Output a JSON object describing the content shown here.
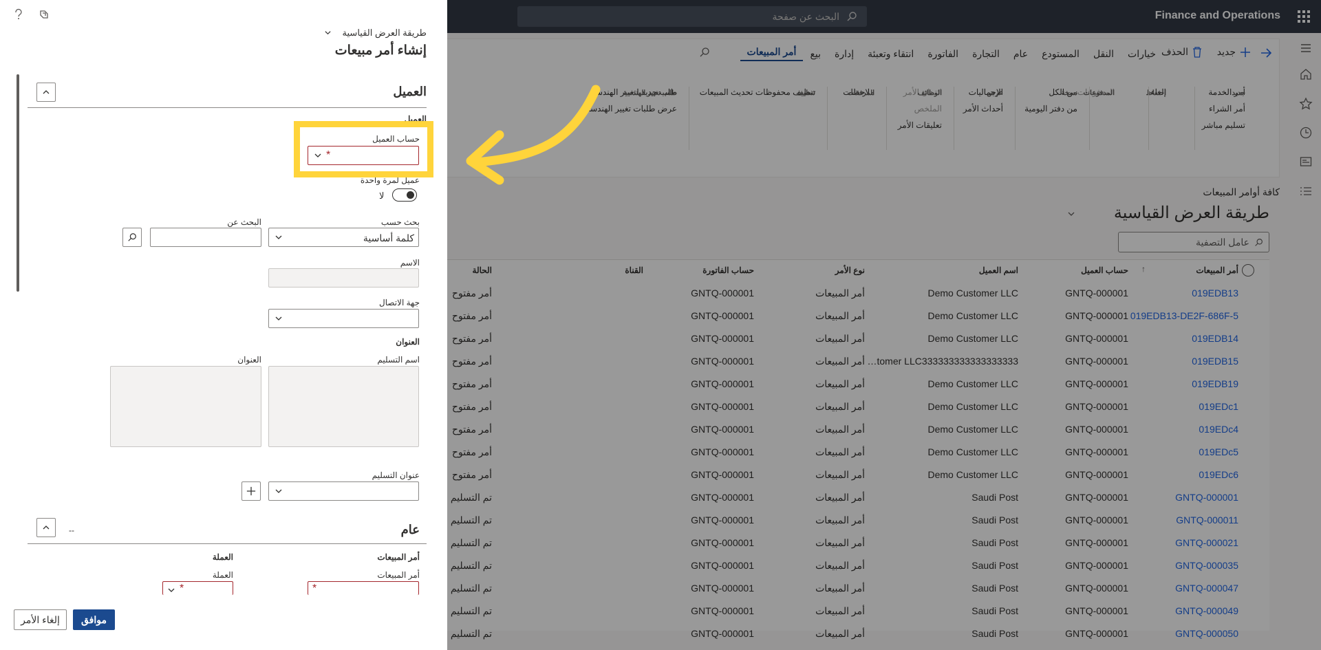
{
  "app": {
    "title": "Finance and Operations",
    "search_placeholder": "البحث عن صفحة"
  },
  "nav_icons": [
    "hamburger-icon",
    "home-icon",
    "star-icon",
    "clock-icon",
    "workspace-icon",
    "list-icon"
  ],
  "toolbar": {
    "back_icon": "back-arrow-icon",
    "new_label": "جديد",
    "delete_label": "الحذف",
    "tabs": [
      "أمر المبيعات",
      "بيع",
      "إدارة",
      "انتقاء وتعبئة",
      "الفاتورة",
      "التجارة",
      "عام",
      "المستودع",
      "النقل",
      "خيارات"
    ]
  },
  "ribbon": {
    "groups": [
      {
        "header": "جديد",
        "items": [
          "أمر الخدمة",
          "أمر الشراء",
          "تسليم مباشر"
        ]
      },
      {
        "header": "احتفاظ",
        "items": [
          "إلغاء"
        ]
      },
      {
        "header": "المدفوعات",
        "items": [
          "المدفوعات"
        ]
      },
      {
        "header": "نسخة",
        "items": [
          "من الكل",
          "من دفتر اليومية"
        ]
      },
      {
        "header": "عرض",
        "items": [
          "الإجماليات",
          "أحداث الأمر"
        ]
      },
      {
        "header": "الوظائف",
        "items": [
          "ائتمان الأمر",
          "الملخص",
          "تعليقات الأمر"
        ]
      },
      {
        "header": "المرفقات",
        "items": [
          "ملاحظات"
        ]
      },
      {
        "header": "تنظيف",
        "items": [
          "تنظيف محفوظات تحديث المبيعات"
        ]
      },
      {
        "header": "طلب تغيير الهندسة",
        "items": [
          "طلب جديد لتغيير الهندسة",
          "عرض طلبات تغيير الهندسة"
        ]
      }
    ]
  },
  "list": {
    "breadcrumb": "كافة أوامر المبيعات",
    "view_title": "طريقة العرض القياسية",
    "filter_placeholder": "عامل التصفية",
    "columns": [
      "أمر المبيعات",
      "حساب العميل",
      "اسم العميل",
      "نوع الأمر",
      "حساب الفاتورة",
      "القناة",
      "الحالة"
    ],
    "rows": [
      [
        "019EDB13",
        "GNTQ-000001",
        "Demo Customer LLC",
        "أمر المبيعات",
        "GNTQ-000001",
        "",
        "أمر مفتوح"
      ],
      [
        "019EDB13-DE2F-686F-5",
        "GNTQ-000001",
        "Demo Customer LLC",
        "أمر المبيعات",
        "GNTQ-000001",
        "",
        "أمر مفتوح"
      ],
      [
        "019EDB14",
        "GNTQ-000001",
        "Demo Customer LLC",
        "أمر المبيعات",
        "GNTQ-000001",
        "",
        "أمر مفتوح"
      ],
      [
        "019EDB15",
        "GNTQ-000001",
        "…tomer LLC333333333333333333",
        "أمر المبيعات",
        "GNTQ-000001",
        "",
        "أمر مفتوح"
      ],
      [
        "019EDB19",
        "GNTQ-000001",
        "Demo Customer LLC",
        "أمر المبيعات",
        "GNTQ-000001",
        "",
        "أمر مفتوح"
      ],
      [
        "019EDc1",
        "GNTQ-000001",
        "Demo Customer LLC",
        "أمر المبيعات",
        "GNTQ-000001",
        "",
        "أمر مفتوح"
      ],
      [
        "019EDc4",
        "GNTQ-000001",
        "Demo Customer LLC",
        "أمر المبيعات",
        "GNTQ-000001",
        "",
        "أمر مفتوح"
      ],
      [
        "019EDc5",
        "GNTQ-000001",
        "Demo Customer LLC",
        "أمر المبيعات",
        "GNTQ-000001",
        "",
        "أمر مفتوح"
      ],
      [
        "019EDc6",
        "GNTQ-000001",
        "Demo Customer LLC",
        "أمر المبيعات",
        "GNTQ-000001",
        "",
        "أمر مفتوح"
      ],
      [
        "GNTQ-000001",
        "GNTQ-000001",
        "Saudi Post",
        "أمر المبيعات",
        "GNTQ-000001",
        "",
        "تم التسليم"
      ],
      [
        "GNTQ-000011",
        "GNTQ-000001",
        "Saudi Post",
        "أمر المبيعات",
        "GNTQ-000001",
        "",
        "تم التسليم"
      ],
      [
        "GNTQ-000021",
        "GNTQ-000001",
        "Saudi Post",
        "أمر المبيعات",
        "GNTQ-000001",
        "",
        "تم التسليم"
      ],
      [
        "GNTQ-000035",
        "GNTQ-000001",
        "Saudi Post",
        "أمر المبيعات",
        "GNTQ-000001",
        "",
        "تم التسليم"
      ],
      [
        "GNTQ-000047",
        "GNTQ-000001",
        "Saudi Post",
        "أمر المبيعات",
        "GNTQ-000001",
        "",
        "تم التسليم"
      ],
      [
        "GNTQ-000049",
        "GNTQ-000001",
        "Saudi Post",
        "أمر المبيعات",
        "GNTQ-000001",
        "",
        "تم التسليم"
      ],
      [
        "GNTQ-000050",
        "GNTQ-000001",
        "Saudi Post",
        "أمر المبيعات",
        "GNTQ-000001",
        "",
        "تم التسليم"
      ]
    ]
  },
  "panel": {
    "view_name": "طريقة العرض القياسية",
    "title": "إنشاء أمر مبيعات",
    "customer_section": "العميل",
    "customer_sub": "العميل",
    "customer_account_label": "حساب العميل",
    "one_time_label": "عميل لمرة واحدة",
    "one_time_value": "لا",
    "search_by_label": "بحث حسب",
    "search_by_value": "كلمة أساسية",
    "search_for_label": "البحث عن",
    "name_label": "الاسم",
    "contact_label": "جهة الاتصال",
    "address_header": "العنوان",
    "delivery_name_label": "اسم التسليم",
    "address_label": "العنوان",
    "delivery_address_label": "عنوان التسليم",
    "general_section": "عام",
    "general_summary": "--",
    "sales_order_header": "أمر المبيعات",
    "currency_header": "العملة",
    "sales_order_label": "أمر المبيعات",
    "currency_label": "العملة",
    "ok_label": "موافق",
    "cancel_label": "إلغاء الأمر",
    "required_mark": "*"
  },
  "colors": {
    "topbar": "#323a45",
    "accent": "#1b4a8f",
    "link": "#2266e3",
    "highlight": "#ffd43b",
    "required": "#a4262c"
  }
}
